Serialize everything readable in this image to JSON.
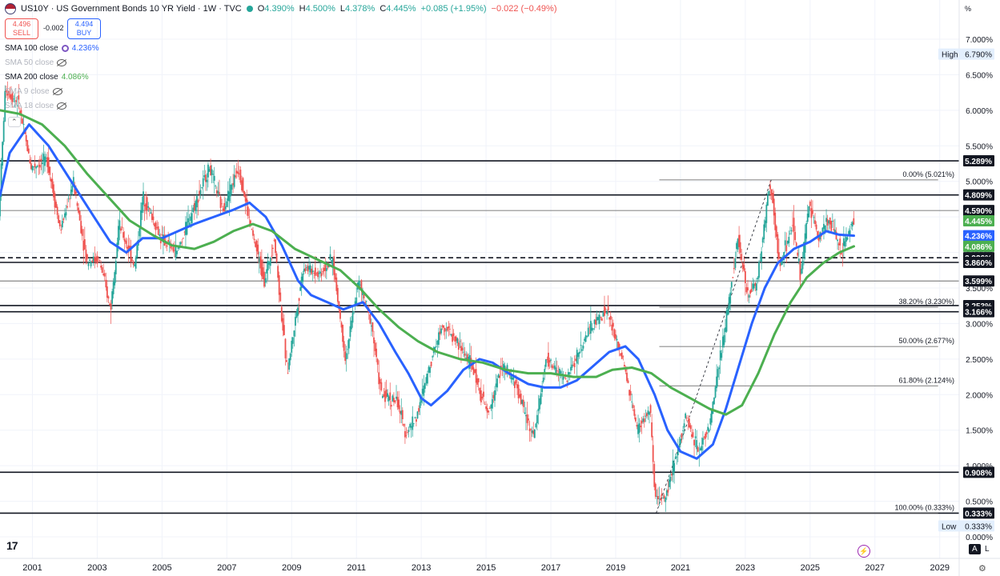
{
  "header": {
    "title": "US10Y · US Government Bonds 10 YR Yield · 1W · TVC",
    "open_label": "O",
    "open": "4.390%",
    "high_label": "H",
    "high": "4.500%",
    "low_label": "L",
    "low": "4.378%",
    "close_label": "C",
    "close": "4.445%",
    "change": "+0.085 (+1.95%)",
    "extra_change": "−0.022 (−0.49%)"
  },
  "trade": {
    "sell_price": "4.496",
    "sell_label": "SELL",
    "spread": "-0.002",
    "buy_price": "4.494",
    "buy_label": "BUY"
  },
  "indicators": [
    {
      "name": "SMA 100 close",
      "value": "4.236%",
      "visible": true,
      "color": "#2962ff"
    },
    {
      "name": "SMA 50 close",
      "value": "",
      "visible": false
    },
    {
      "name": "SMA 200 close",
      "value": "4.086%",
      "visible": true,
      "color": "#4caf50"
    },
    {
      "name": "SMA 9 close",
      "value": "",
      "visible": false
    },
    {
      "name": "SMA 18 close",
      "value": "",
      "visible": false
    }
  ],
  "toolbar": {
    "percent_toggle": "%",
    "auto_label": "A",
    "log_label": "L"
  },
  "chart_data": {
    "type": "candlestick",
    "interval": "1W",
    "x_range": [
      2000,
      2029.6
    ],
    "x_ticks": [
      "2001",
      "2003",
      "2005",
      "2007",
      "2009",
      "2011",
      "2013",
      "2015",
      "2017",
      "2019",
      "2021",
      "2023",
      "2025",
      "2027",
      "2029"
    ],
    "y_range": [
      0.0,
      7.3
    ],
    "y_ticks": [
      "7.000%",
      "6.500%",
      "6.000%",
      "5.500%",
      "5.000%",
      "4.500%",
      "4.000%",
      "3.500%",
      "3.000%",
      "2.500%",
      "2.000%",
      "1.500%",
      "1.000%",
      "0.500%",
      "0.000%"
    ],
    "y_ticks_values": [
      7.0,
      6.5,
      6.0,
      5.5,
      5.0,
      4.5,
      4.0,
      3.5,
      3.0,
      2.5,
      2.0,
      1.5,
      1.0,
      0.5,
      0.0
    ],
    "high_label": "High",
    "high_value": "6.790%",
    "low_label": "Low",
    "low_value": "0.333%",
    "price_path": [
      [
        2000.0,
        4.5
      ],
      [
        2000.2,
        6.3
      ],
      [
        2000.6,
        6.1
      ],
      [
        2001.0,
        5.2
      ],
      [
        2001.5,
        5.3
      ],
      [
        2001.9,
        4.3
      ],
      [
        2002.3,
        5.0
      ],
      [
        2002.7,
        3.9
      ],
      [
        2003.1,
        3.9
      ],
      [
        2003.45,
        3.2
      ],
      [
        2003.7,
        4.4
      ],
      [
        2004.2,
        3.8
      ],
      [
        2004.45,
        4.8
      ],
      [
        2005.0,
        4.2
      ],
      [
        2005.5,
        4.0
      ],
      [
        2005.9,
        4.5
      ],
      [
        2006.5,
        5.2
      ],
      [
        2006.9,
        4.6
      ],
      [
        2007.4,
        5.2
      ],
      [
        2007.8,
        4.3
      ],
      [
        2008.2,
        3.6
      ],
      [
        2008.5,
        4.2
      ],
      [
        2008.9,
        2.3
      ],
      [
        2009.4,
        3.8
      ],
      [
        2009.9,
        3.7
      ],
      [
        2010.3,
        3.9
      ],
      [
        2010.7,
        2.5
      ],
      [
        2011.1,
        3.6
      ],
      [
        2011.5,
        3.0
      ],
      [
        2011.8,
        2.0
      ],
      [
        2012.3,
        1.9
      ],
      [
        2012.55,
        1.45
      ],
      [
        2012.9,
        1.7
      ],
      [
        2013.4,
        2.6
      ],
      [
        2013.7,
        3.0
      ],
      [
        2014.2,
        2.7
      ],
      [
        2014.6,
        2.4
      ],
      [
        2015.1,
        1.7
      ],
      [
        2015.5,
        2.4
      ],
      [
        2015.9,
        2.2
      ],
      [
        2016.5,
        1.4
      ],
      [
        2016.9,
        2.5
      ],
      [
        2017.5,
        2.2
      ],
      [
        2018.2,
        2.9
      ],
      [
        2018.75,
        3.2
      ],
      [
        2019.3,
        2.4
      ],
      [
        2019.7,
        1.5
      ],
      [
        2020.1,
        1.8
      ],
      [
        2020.25,
        0.5
      ],
      [
        2020.6,
        0.6
      ],
      [
        2021.2,
        1.7
      ],
      [
        2021.6,
        1.2
      ],
      [
        2021.95,
        1.6
      ],
      [
        2022.4,
        2.9
      ],
      [
        2022.8,
        4.2
      ],
      [
        2023.1,
        3.4
      ],
      [
        2023.4,
        3.6
      ],
      [
        2023.8,
        5.0
      ],
      [
        2024.1,
        3.8
      ],
      [
        2024.5,
        4.4
      ],
      [
        2024.75,
        3.65
      ],
      [
        2025.0,
        4.7
      ],
      [
        2025.3,
        4.2
      ],
      [
        2025.6,
        4.5
      ],
      [
        2026.0,
        4.0
      ],
      [
        2026.35,
        4.445
      ]
    ],
    "series": [
      {
        "name": "SMA 100 close",
        "color": "#2962ff",
        "values": [
          [
            2000.0,
            4.8
          ],
          [
            2000.3,
            5.4
          ],
          [
            2000.9,
            5.8
          ],
          [
            2001.5,
            5.5
          ],
          [
            2002.2,
            5.0
          ],
          [
            2002.9,
            4.5
          ],
          [
            2003.4,
            4.15
          ],
          [
            2003.9,
            4.0
          ],
          [
            2004.4,
            4.2
          ],
          [
            2005.0,
            4.2
          ],
          [
            2005.5,
            4.3
          ],
          [
            2006.0,
            4.4
          ],
          [
            2006.6,
            4.5
          ],
          [
            2007.2,
            4.6
          ],
          [
            2007.7,
            4.7
          ],
          [
            2008.2,
            4.5
          ],
          [
            2008.7,
            4.1
          ],
          [
            2009.2,
            3.6
          ],
          [
            2009.6,
            3.4
          ],
          [
            2010.1,
            3.3
          ],
          [
            2010.6,
            3.2
          ],
          [
            2011.2,
            3.3
          ],
          [
            2011.7,
            3.0
          ],
          [
            2012.2,
            2.6
          ],
          [
            2012.6,
            2.3
          ],
          [
            2013.0,
            1.95
          ],
          [
            2013.3,
            1.85
          ],
          [
            2013.8,
            2.05
          ],
          [
            2014.3,
            2.35
          ],
          [
            2014.8,
            2.5
          ],
          [
            2015.2,
            2.45
          ],
          [
            2015.7,
            2.3
          ],
          [
            2016.3,
            2.15
          ],
          [
            2016.8,
            2.1
          ],
          [
            2017.3,
            2.1
          ],
          [
            2017.8,
            2.2
          ],
          [
            2018.3,
            2.4
          ],
          [
            2018.8,
            2.6
          ],
          [
            2019.3,
            2.68
          ],
          [
            2019.7,
            2.5
          ],
          [
            2020.2,
            2.0
          ],
          [
            2020.6,
            1.5
          ],
          [
            2021.0,
            1.2
          ],
          [
            2021.5,
            1.1
          ],
          [
            2022.0,
            1.3
          ],
          [
            2022.4,
            1.8
          ],
          [
            2022.8,
            2.4
          ],
          [
            2023.2,
            3.0
          ],
          [
            2023.6,
            3.5
          ],
          [
            2024.0,
            3.85
          ],
          [
            2024.5,
            4.05
          ],
          [
            2025.0,
            4.15
          ],
          [
            2025.5,
            4.3
          ],
          [
            2025.9,
            4.25
          ],
          [
            2026.35,
            4.236
          ]
        ]
      },
      {
        "name": "SMA 200 close",
        "color": "#4caf50",
        "values": [
          [
            2000.0,
            6.0
          ],
          [
            2000.6,
            5.95
          ],
          [
            2001.3,
            5.8
          ],
          [
            2002.0,
            5.5
          ],
          [
            2002.7,
            5.1
          ],
          [
            2003.3,
            4.8
          ],
          [
            2004.0,
            4.45
          ],
          [
            2004.7,
            4.25
          ],
          [
            2005.3,
            4.1
          ],
          [
            2006.0,
            4.05
          ],
          [
            2006.6,
            4.15
          ],
          [
            2007.2,
            4.3
          ],
          [
            2007.8,
            4.4
          ],
          [
            2008.4,
            4.3
          ],
          [
            2009.1,
            4.05
          ],
          [
            2009.8,
            3.9
          ],
          [
            2010.5,
            3.75
          ],
          [
            2011.1,
            3.5
          ],
          [
            2011.7,
            3.2
          ],
          [
            2012.3,
            2.95
          ],
          [
            2012.9,
            2.75
          ],
          [
            2013.5,
            2.6
          ],
          [
            2014.2,
            2.5
          ],
          [
            2014.9,
            2.45
          ],
          [
            2015.6,
            2.35
          ],
          [
            2016.3,
            2.3
          ],
          [
            2017.0,
            2.3
          ],
          [
            2017.7,
            2.25
          ],
          [
            2018.4,
            2.25
          ],
          [
            2018.9,
            2.35
          ],
          [
            2019.5,
            2.38
          ],
          [
            2020.1,
            2.3
          ],
          [
            2020.7,
            2.1
          ],
          [
            2021.3,
            1.95
          ],
          [
            2021.9,
            1.8
          ],
          [
            2022.4,
            1.72
          ],
          [
            2022.9,
            1.85
          ],
          [
            2023.4,
            2.3
          ],
          [
            2023.9,
            2.85
          ],
          [
            2024.4,
            3.3
          ],
          [
            2024.9,
            3.65
          ],
          [
            2025.4,
            3.85
          ],
          [
            2025.9,
            4.0
          ],
          [
            2026.35,
            4.086
          ]
        ]
      }
    ],
    "horizontal_levels": [
      {
        "value": 5.289,
        "label": "5.289%",
        "style": "solid"
      },
      {
        "value": 4.809,
        "label": "4.809%",
        "style": "solid"
      },
      {
        "value": 4.59,
        "label": "4.590%",
        "style": "thin"
      },
      {
        "value": 3.926,
        "label": "3.926%",
        "style": "dashed"
      },
      {
        "value": 3.86,
        "label": "3.860%",
        "style": "solid"
      },
      {
        "value": 3.599,
        "label": "3.599%",
        "style": "thin"
      },
      {
        "value": 3.253,
        "label": "3.253%",
        "style": "solid"
      },
      {
        "value": 3.166,
        "label": "3.166%",
        "style": "solid"
      },
      {
        "value": 0.908,
        "label": "0.908%",
        "style": "solid"
      },
      {
        "value": 0.333,
        "label": "0.333%",
        "style": "solid"
      }
    ],
    "price_tags": [
      {
        "value": 4.445,
        "label": "4.445%",
        "color": "#4caf50"
      },
      {
        "value": 4.236,
        "label": "4.236%",
        "color": "#2962ff"
      },
      {
        "value": 4.086,
        "label": "4.086%",
        "color": "#4caf50"
      }
    ],
    "fibonacci": {
      "x_start": 2020.0,
      "x_end": 2029.0,
      "levels": [
        {
          "value": 5.021,
          "label": "0.00% (5.021%)"
        },
        {
          "value": 3.23,
          "label": "38.20% (3.230%)"
        },
        {
          "value": 2.677,
          "label": "50.00% (2.677%)"
        },
        {
          "value": 2.124,
          "label": "61.80% (2.124%)"
        },
        {
          "value": 0.333,
          "label": "100.00% (0.333%)"
        }
      ],
      "trend_line": [
        [
          2020.25,
          0.333
        ],
        [
          2023.8,
          5.021
        ]
      ]
    }
  }
}
